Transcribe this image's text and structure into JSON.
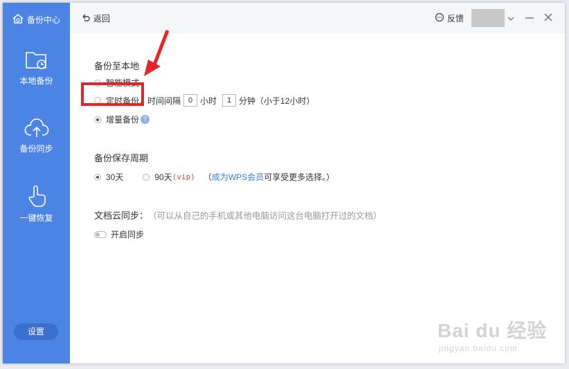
{
  "sidebar": {
    "brand": "备份中心",
    "items": [
      {
        "label": "本地备份"
      },
      {
        "label": "备份同步"
      },
      {
        "label": "一键恢复"
      }
    ],
    "settings": "设置"
  },
  "topbar": {
    "back": "返回",
    "feedback": "反馈"
  },
  "local_backup": {
    "title": "备份至本地",
    "smart_mode": "智能模式",
    "scheduled": "定时备份，",
    "interval_label": "时间间隔",
    "hours_value": "0",
    "hours_unit": "小时",
    "minutes_value": "1",
    "minutes_unit": "分钟（小于12小时）",
    "incremental": "增量备份",
    "help_mark": "?",
    "selected": "incremental"
  },
  "retention": {
    "title": "备份保存周期",
    "opt1": "30天",
    "opt2": "90天",
    "vip": "(vip)",
    "note_open": "（",
    "link": "成为WPS会员",
    "note_rest": " 可享受更多选择。）"
  },
  "cloud_sync": {
    "title": "文档云同步：",
    "hint": "（可以从自己的手机或其他电脑访问这台电脑打开过的文档）",
    "toggle_label": "开启同步"
  },
  "watermark": {
    "main": "Bai du 经验",
    "sub": "jingyan.baidu.com"
  },
  "colors": {
    "sidebar": "#4c84e4",
    "accent_link": "#3b7be0",
    "highlight": "#e8232a"
  }
}
